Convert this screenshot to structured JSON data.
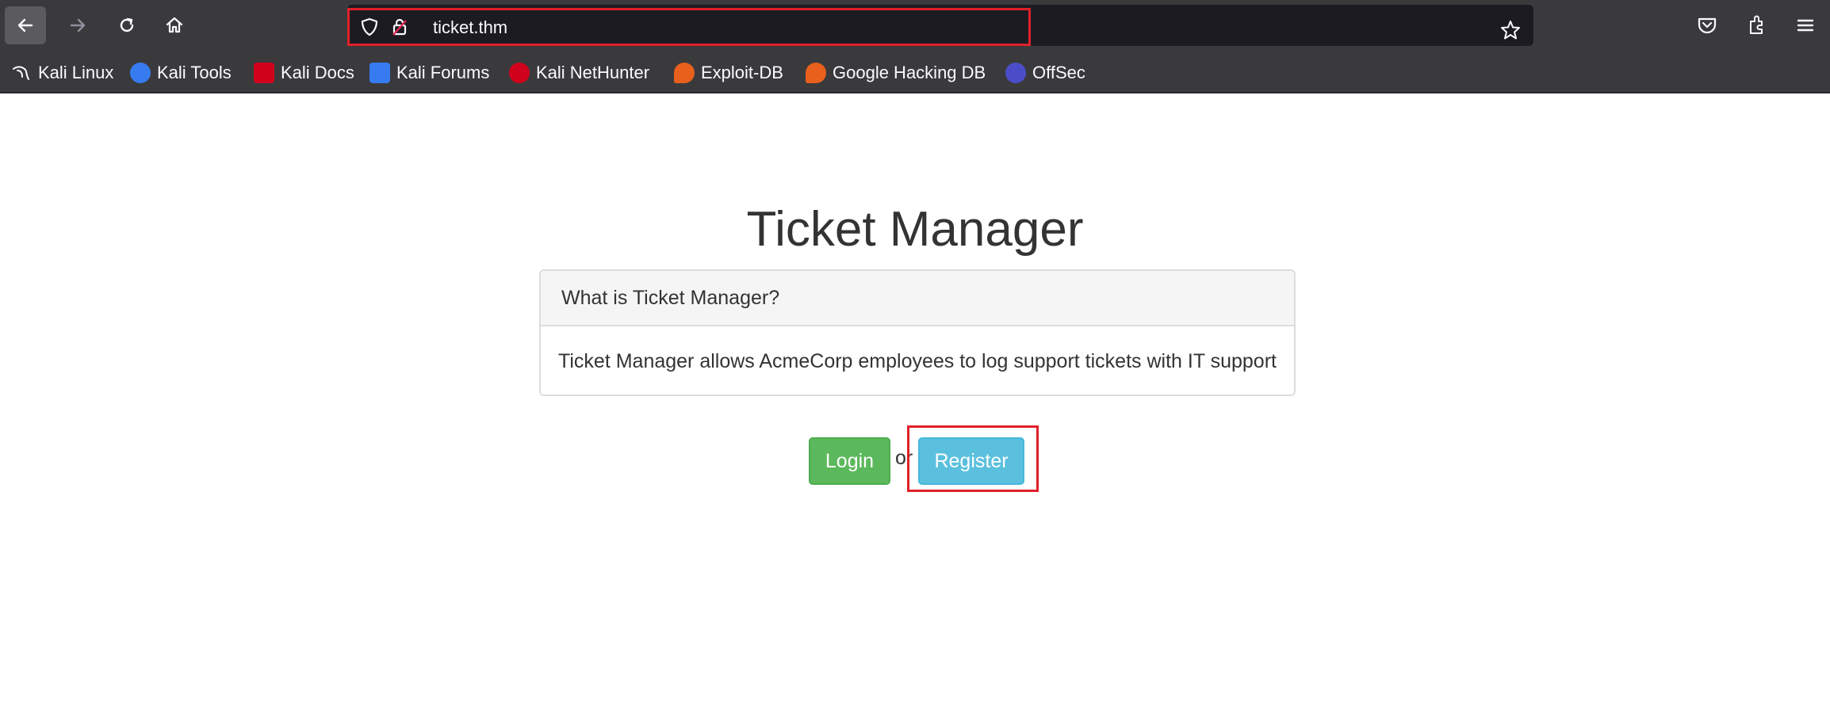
{
  "browser": {
    "url": "ticket.thm",
    "bookmarks": [
      {
        "label": "Kali Linux",
        "icon": "kali-dragon-icon",
        "color": "#1a1a1a"
      },
      {
        "label": "Kali Tools",
        "icon": "kali-tools-icon",
        "color": "#367bf0"
      },
      {
        "label": "Kali Docs",
        "icon": "kali-docs-icon",
        "color": "#d0021b"
      },
      {
        "label": "Kali Forums",
        "icon": "kali-forums-icon",
        "color": "#367bf0"
      },
      {
        "label": "Kali NetHunter",
        "icon": "nethunter-icon",
        "color": "#d0021b"
      },
      {
        "label": "Exploit-DB",
        "icon": "exploit-db-icon",
        "color": "#e8601c"
      },
      {
        "label": "Google Hacking DB",
        "icon": "ghdb-icon",
        "color": "#e8601c"
      },
      {
        "label": "OffSec",
        "icon": "offsec-icon",
        "color": "#4b4dc8"
      }
    ]
  },
  "page": {
    "title": "Ticket Manager",
    "panel": {
      "heading": "What is Ticket Manager?",
      "body": "Ticket Manager allows AcmeCorp employees to log support tickets with IT support"
    },
    "login_label": "Login",
    "or_label": "or",
    "register_label": "Register"
  }
}
